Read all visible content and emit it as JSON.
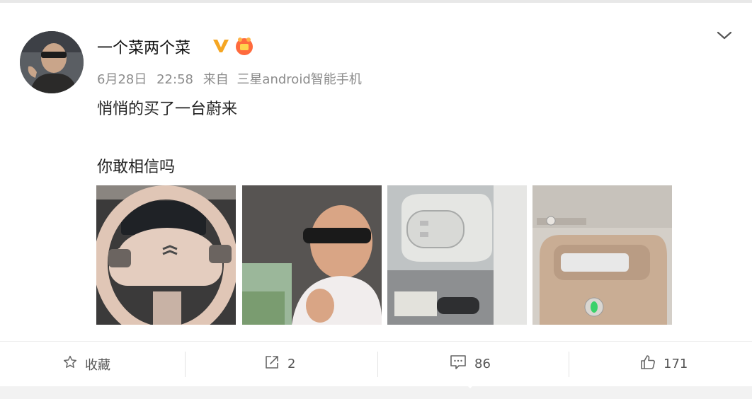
{
  "post": {
    "username": "一个菜两个菜",
    "verified_icon": "verified-v-icon",
    "fan_badge_icon": "fan-badge-icon",
    "date": "6月28日",
    "time": "22:58",
    "source_prefix": "来自",
    "source": "三星android智能手机",
    "text_line1": "悄悄的买了一台蔚来",
    "text_line2": "你敢相信吗",
    "images": [
      {
        "icon": "steering-wheel-photo"
      },
      {
        "icon": "selfie-in-car-photo"
      },
      {
        "icon": "car-key-photo"
      },
      {
        "icon": "center-console-photo"
      }
    ]
  },
  "actions": {
    "favorite_label": "收藏",
    "share_count": "2",
    "comment_count": "86",
    "like_count": "171"
  },
  "colors": {
    "verified": "#f5a623",
    "badge": "#ff6a3d",
    "meta_text": "#8c8c8c"
  }
}
